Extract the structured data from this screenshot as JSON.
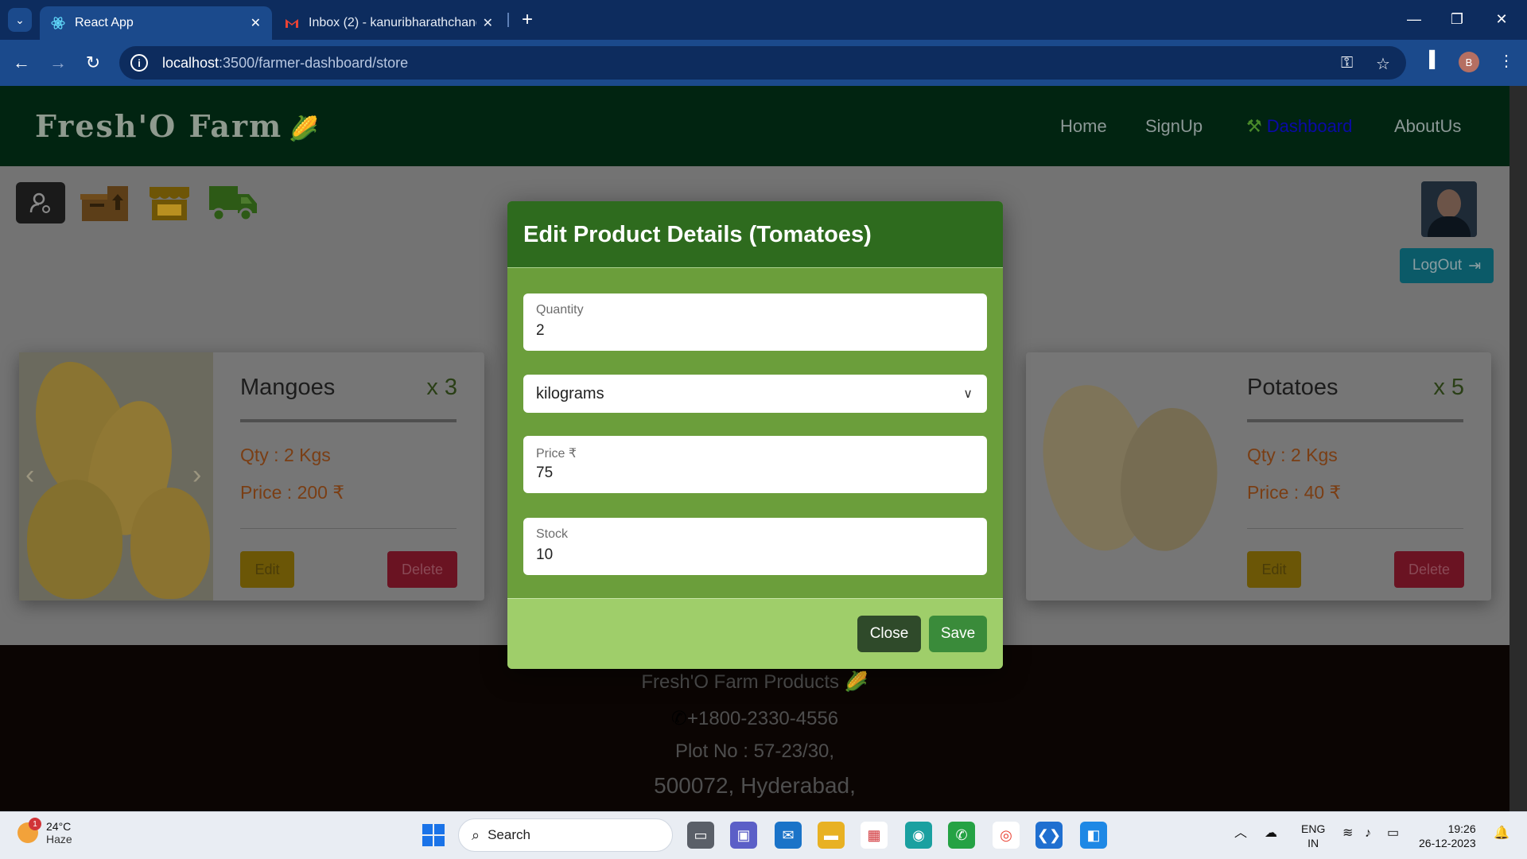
{
  "browser": {
    "tabs": [
      {
        "title": "React App",
        "active": true
      },
      {
        "title": "Inbox (2) - kanuribharathchandra",
        "active": false
      }
    ],
    "url_host": "localhost",
    "url_path": ":3500/farmer-dashboard/store"
  },
  "navbar": {
    "logo": "Fresh'O Farm",
    "links": [
      "Home",
      "SignUp",
      "Dashboard",
      "AboutUs"
    ]
  },
  "sidebar_icons": [
    "admin-icon",
    "box-upload-icon",
    "store-icon",
    "truck-icon"
  ],
  "logout_label": "LogOut",
  "products": [
    {
      "name": "Mangoes",
      "count": "x 3",
      "qty": "Qty : 2 Kgs",
      "price": "Price : 200 ₹",
      "edit": "Edit",
      "delete": "Delete"
    },
    {
      "name": "Potatoes",
      "count": "x 5",
      "qty": "Qty : 2 Kgs",
      "price": "Price : 40 ₹",
      "edit": "Edit",
      "delete": "Delete"
    }
  ],
  "modal": {
    "title": "Edit Product Details (Tomatoes)",
    "quantity_label": "Quantity",
    "quantity_value": "2",
    "unit_selected": "kilograms",
    "price_label": "Price ₹",
    "price_value": "75",
    "stock_label": "Stock",
    "stock_value": "10",
    "close_label": "Close",
    "save_label": "Save"
  },
  "footer": {
    "company": "Fresh'O Farm Products",
    "phone": "+1800-2330-4556",
    "address1": "Plot No : 57-23/30,",
    "address2": "500072, Hyderabad,"
  },
  "taskbar": {
    "weather_temp": "24°C",
    "weather_desc": "Haze",
    "weather_badge": "1",
    "search_label": "Search",
    "lang1": "ENG",
    "lang2": "IN",
    "time": "19:26",
    "date": "26-12-2023"
  },
  "colors": {
    "navbar": "#012411",
    "modal_header": "#2e6b1e",
    "modal_body": "#6b9e3b",
    "modal_footer": "#9fce6a"
  }
}
